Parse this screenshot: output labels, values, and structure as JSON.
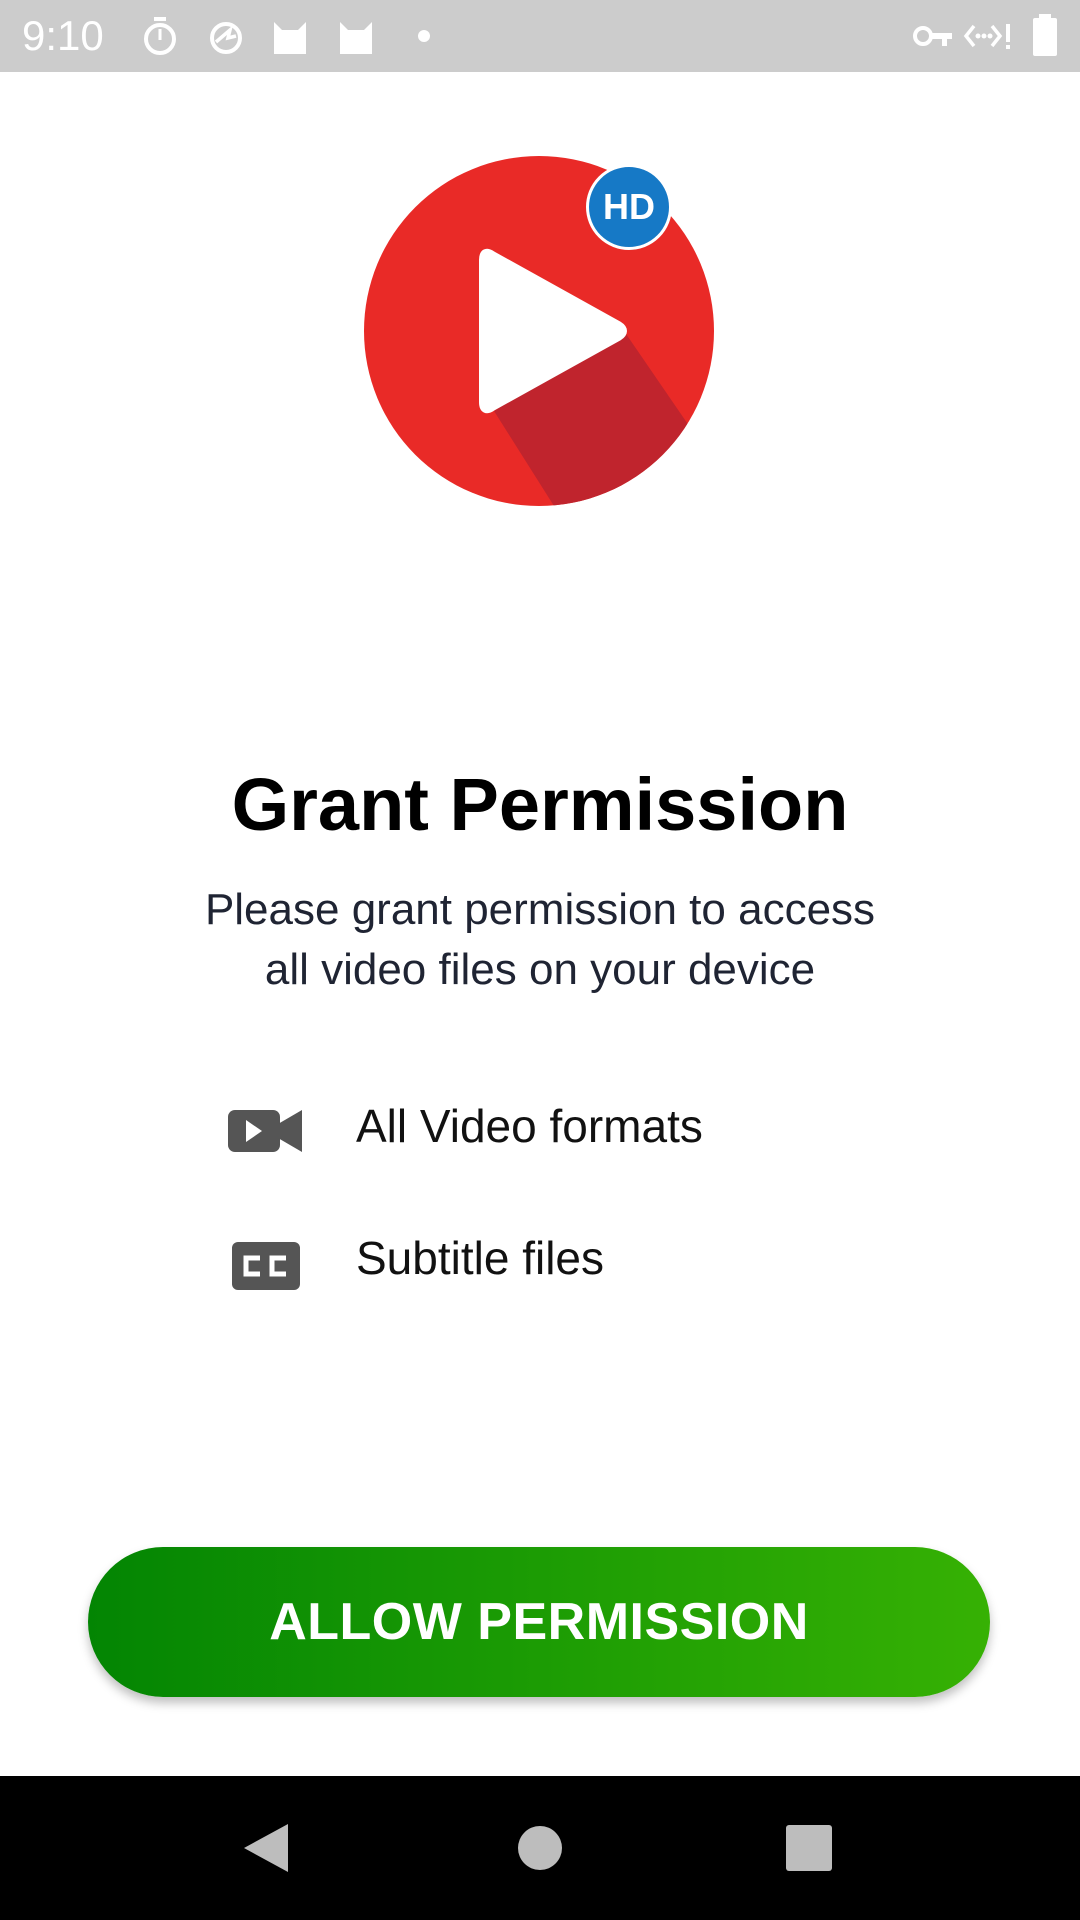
{
  "status_bar": {
    "time": "9:10",
    "left_icons": [
      "stopwatch-icon",
      "sync-icon",
      "cat-icon",
      "cat-icon",
      "dot-icon"
    ],
    "right_icons": [
      "vpn-key-icon",
      "data-arrows-icon",
      "battery-icon"
    ],
    "background_color": "#cccccc"
  },
  "logo": {
    "icon": "play-icon",
    "badge": "HD",
    "circle_color": "#e92a27",
    "badge_color": "#1679c6"
  },
  "content": {
    "title": "Grant Permission",
    "subtitle_line1": "Please grant permission to access",
    "subtitle_line2": "all video files on your device",
    "features": [
      {
        "icon": "video-camera-icon",
        "label": "All Video formats"
      },
      {
        "icon": "closed-caption-icon",
        "label": "Subtitle files"
      }
    ]
  },
  "button": {
    "label": "ALLOW PERMISSION",
    "gradient_start": "#038503",
    "gradient_end": "#36b104"
  },
  "nav_bar": {
    "buttons": [
      "back-icon",
      "home-icon",
      "recents-icon"
    ]
  }
}
